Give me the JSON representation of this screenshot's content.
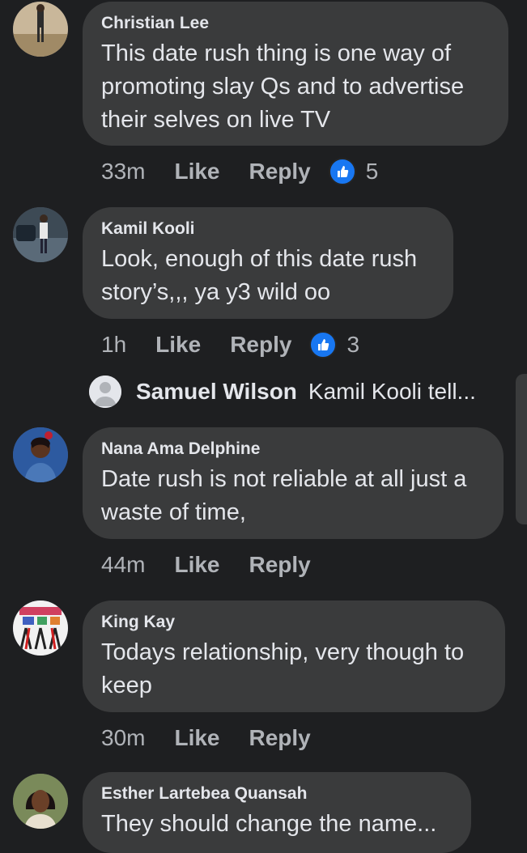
{
  "comments": [
    {
      "author": "Christian Lee",
      "text": "This date rush thing is one way of promoting slay  Qs and to advertise their selves on live TV",
      "time": "33m",
      "like": "Like",
      "reply": "Reply",
      "reactions": "5"
    },
    {
      "author": "Kamil Kooli",
      "text": "Look, enough of this date rush story’s,,, ya y3 wild oo",
      "time": "1h",
      "like": "Like",
      "reply": "Reply",
      "reactions": "3"
    },
    {
      "author": "Nana Ama Delphine",
      "text": "Date rush is not reliable at all just a waste of time,",
      "time": "44m",
      "like": "Like",
      "reply": "Reply"
    },
    {
      "author": "King Kay",
      "text": "Todays relationship, very though to keep",
      "time": "30m",
      "like": "Like",
      "reply": "Reply"
    },
    {
      "author": "Esther Lartebea Quansah",
      "text": "They should change the name..."
    }
  ],
  "reply_preview": {
    "author": "Samuel Wilson",
    "text": "Kamil Kooli tell..."
  },
  "colors": {
    "background": "#1e1f21",
    "bubble": "#3a3b3c",
    "like_icon": "#1877f2",
    "muted_text": "#b0b3b8"
  }
}
